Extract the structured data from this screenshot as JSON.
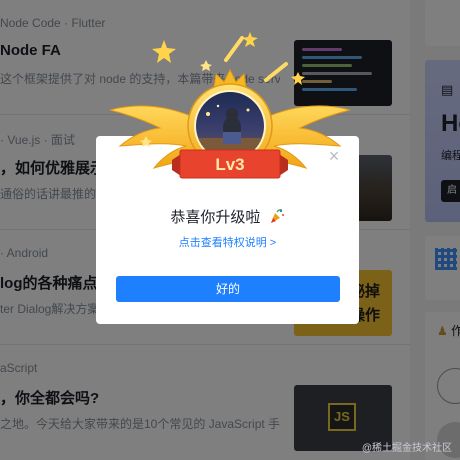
{
  "feed": {
    "articles": [
      {
        "meta": "Node Code · Flutter",
        "title": "Node FA",
        "desc": "这个框架提供了对 node 的支持，本篇带来 code server"
      },
      {
        "meta": "· Vue.js · 面试",
        "title": "，如何优雅展示，",
        "desc": "通俗的话讲最推的知"
      },
      {
        "meta": "· Android",
        "title": "log的各种痛点!",
        "desc": "ter Dialog解决方案。"
      },
      {
        "meta": "aScript",
        "title": "，你全都会吗?",
        "desc": "之地。今天给大家带来的是10个常见的 JavaScript 手写..."
      }
    ],
    "thumb_texts": {
      "dialog_line1": "秘掉",
      "dialog_line2": "操作",
      "js": "JS"
    }
  },
  "sidebar": {
    "promo_heading": "Ho",
    "promo_sub": "编程",
    "promo_button": "启",
    "book_icon": "book-icon",
    "author_heading": "作",
    "author_icon": "trophy-icon"
  },
  "modal": {
    "level": "Lv3",
    "title": "恭喜你升级啦",
    "link": "点击查看特权说明 >",
    "confirm": "好的",
    "close": "×"
  },
  "watermark": "@稀土掘金技术社区",
  "colors": {
    "accent": "#1e80ff",
    "gold": "#f5b822",
    "ribbon": "#e8442d"
  }
}
